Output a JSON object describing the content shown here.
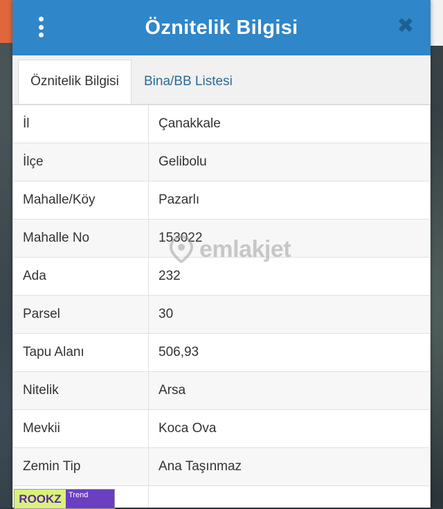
{
  "dialog": {
    "title": "Öznitelik Bilgisi",
    "close_symbol": "✖"
  },
  "tabs": [
    {
      "label": "Öznitelik Bilgisi",
      "active": true
    },
    {
      "label": "Bina/BB Listesi",
      "active": false
    }
  ],
  "rows": [
    {
      "key": "İl",
      "value": "Çanakkale"
    },
    {
      "key": "İlçe",
      "value": "Gelibolu"
    },
    {
      "key": "Mahalle/Köy",
      "value": "Pazarlı"
    },
    {
      "key": "Mahalle No",
      "value": "153022"
    },
    {
      "key": "Ada",
      "value": "232"
    },
    {
      "key": "Parsel",
      "value": "30"
    },
    {
      "key": "Tapu Alanı",
      "value": "506,93"
    },
    {
      "key": "Nitelik",
      "value": "Arsa"
    },
    {
      "key": "Mevkii",
      "value": "Koca Ova"
    },
    {
      "key": "Zemin Tip",
      "value": "Ana Taşınmaz"
    }
  ],
  "watermark": {
    "text": "emlakjet"
  },
  "badge": {
    "logo": "ROOKZ",
    "text": "Trend"
  },
  "icons": {
    "menu": "more-vertical-icon",
    "close": "close-icon",
    "watermark": "location-pin-icon"
  },
  "colors": {
    "header": "#2f86c9",
    "tab_link": "#2b6a97",
    "close": "#1e5f94"
  }
}
